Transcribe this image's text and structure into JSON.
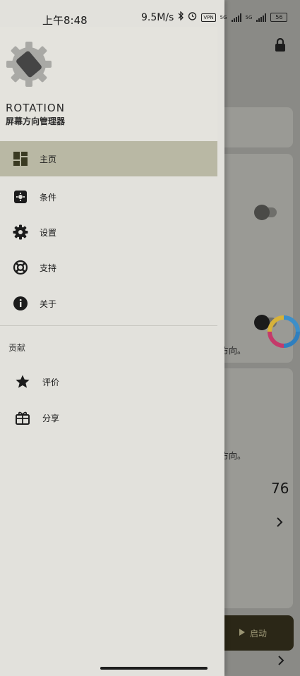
{
  "status_bar": {
    "time": "上午8:48",
    "speed": "9.5M/s",
    "vpn": "VPN",
    "net1": "5G",
    "net2": "5G",
    "battery": "56"
  },
  "drawer": {
    "app_name": "ROTATION",
    "app_subtitle": "屏幕方向管理器",
    "items": [
      {
        "label": "主页",
        "icon": "dashboard-icon",
        "active": true
      },
      {
        "label": "条件",
        "icon": "conditions-icon",
        "active": false
      },
      {
        "label": "设置",
        "icon": "gear-icon",
        "active": false
      },
      {
        "label": "支持",
        "icon": "lifebuoy-icon",
        "active": false
      },
      {
        "label": "关于",
        "icon": "info-icon",
        "active": false
      }
    ],
    "section_title": "贡献",
    "contrib_items": [
      {
        "label": "评价",
        "icon": "star-icon"
      },
      {
        "label": "分享",
        "icon": "gift-icon"
      }
    ]
  },
  "background": {
    "text1": "方向。",
    "text2": "方向。",
    "number": "76",
    "start_label": "启动"
  },
  "colors": {
    "drawer_bg": "#e2e1dc",
    "active_bg": "#b9b8a4",
    "start_button": "#2b2717"
  }
}
